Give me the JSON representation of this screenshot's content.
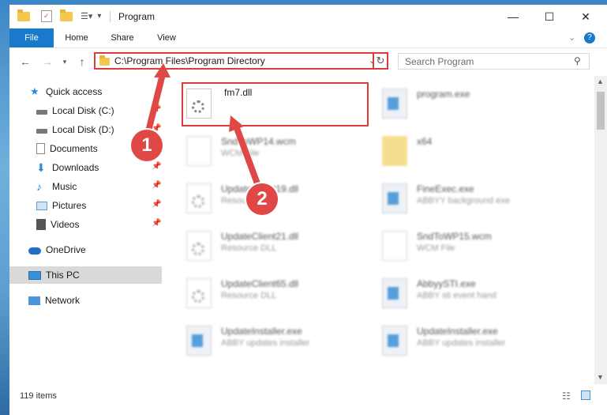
{
  "window": {
    "title": "Program"
  },
  "ribbon": {
    "tabs": [
      "File",
      "Home",
      "Share",
      "View"
    ]
  },
  "address": {
    "path": "C:\\Program Files\\Program Directory"
  },
  "search": {
    "placeholder": "Search Program"
  },
  "sidebar": {
    "items": [
      {
        "label": "Quick access",
        "icon": "star-icon"
      },
      {
        "label": "Local Disk (C:)",
        "icon": "drive-icon"
      },
      {
        "label": "Local Disk (D:)",
        "icon": "drive-icon"
      },
      {
        "label": "Documents",
        "icon": "documents-icon"
      },
      {
        "label": "Downloads",
        "icon": "download-icon"
      },
      {
        "label": "Music",
        "icon": "music-icon"
      },
      {
        "label": "Pictures",
        "icon": "pictures-icon"
      },
      {
        "label": "Videos",
        "icon": "videos-icon"
      },
      {
        "label": "OneDrive",
        "icon": "cloud-icon"
      },
      {
        "label": "This PC",
        "icon": "pc-icon"
      },
      {
        "label": "Network",
        "icon": "network-icon"
      }
    ]
  },
  "files": [
    {
      "name": "fm7.dll",
      "sub": "",
      "type": "dll"
    },
    {
      "name": "program.exe",
      "sub": "",
      "type": "exe"
    },
    {
      "name": "SndToWP14.wcm",
      "sub": "WCM File",
      "type": "doc"
    },
    {
      "name": "x64",
      "sub": "",
      "type": "folder"
    },
    {
      "name": "UpdateClient19.dll",
      "sub": "Resource DLL",
      "type": "dll"
    },
    {
      "name": "FineExec.exe",
      "sub": "ABBYY background exe",
      "type": "exe"
    },
    {
      "name": "UpdateClient21.dll",
      "sub": "Resource DLL",
      "type": "dll"
    },
    {
      "name": "SndToWP15.wcm",
      "sub": "WCM File",
      "type": "doc"
    },
    {
      "name": "UpdateClient65.dll",
      "sub": "Resource DLL",
      "type": "dll"
    },
    {
      "name": "AbbyySTI.exe",
      "sub": "ABBY sti event hand",
      "type": "exe"
    },
    {
      "name": "UpdateInstaller.exe",
      "sub": "ABBY updates installer",
      "type": "exe"
    },
    {
      "name": "UpdateInstaller.exe",
      "sub": "ABBY updates installer",
      "type": "exe"
    }
  ],
  "status": {
    "count": "119 items"
  },
  "annotations": {
    "step1": "1",
    "step2": "2"
  },
  "colors": {
    "accent": "#1979ca",
    "highlight": "#e03b3b"
  }
}
